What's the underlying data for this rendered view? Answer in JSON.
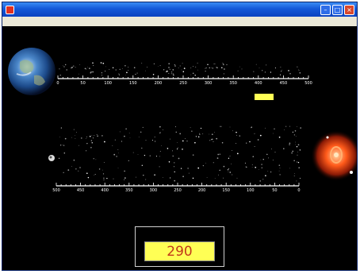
{
  "window": {
    "title": "",
    "minimize_glyph": "–",
    "maximize_glyph": "□",
    "close_glyph": "×"
  },
  "menu": {
    "items": [
      "",
      ""
    ]
  },
  "top_scale": {
    "ticks": [
      "0",
      "50",
      "100",
      "150",
      "200",
      "250",
      "300",
      "350",
      "400",
      "450",
      "500"
    ]
  },
  "bottom_scale": {
    "ticks": [
      "500",
      "450",
      "400",
      "350",
      "300",
      "250",
      "200",
      "150",
      "100",
      "50",
      "0"
    ]
  },
  "earth_caption": "",
  "distance_caption": "",
  "distance_unit": "",
  "distance_value": "",
  "top_marker": "",
  "bottom_marker": "",
  "source_caption": "",
  "counter": {
    "label": "",
    "value": "290"
  },
  "colors": {
    "caption_yellow": "#f2f200",
    "marker_red": "#ff2a2a",
    "field_yellow": "#ffff55",
    "value_red": "#c23a1a"
  }
}
